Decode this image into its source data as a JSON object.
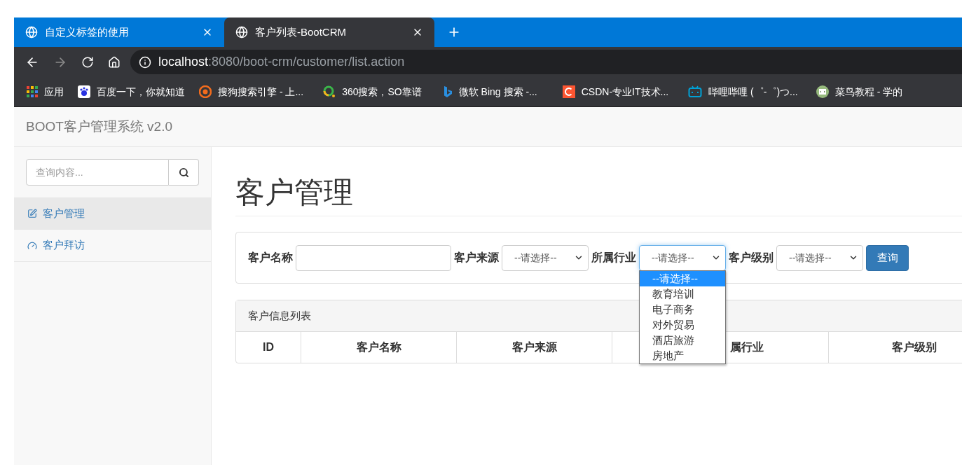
{
  "browser": {
    "tabs": [
      {
        "title": "自定义标签的使用",
        "selected": false
      },
      {
        "title": "客户列表-BootCRM",
        "selected": true
      }
    ],
    "url": {
      "host": "localhost",
      "rest": ":8080/boot-crm/customer/list.action"
    },
    "bookmarks": [
      {
        "label": "应用",
        "kind": "apps"
      },
      {
        "label": "百度一下，你就知道",
        "kind": "paw"
      },
      {
        "label": "搜狗搜索引擎 - 上...",
        "kind": "scircle"
      },
      {
        "label": "360搜索，SO靠谱",
        "kind": "ring"
      },
      {
        "label": "微软 Bing 搜索 -...",
        "kind": "ribbon"
      },
      {
        "label": "CSDN-专业IT技术...",
        "kind": "csquare"
      },
      {
        "label": "哔哩哔哩 (゜-゜)つ...",
        "kind": "tv"
      },
      {
        "label": "菜鸟教程 - 学的",
        "kind": "codebadge"
      }
    ]
  },
  "navbar": {
    "brand": "BOOT客户管理系统 v2.0"
  },
  "sidebar": {
    "search": {
      "placeholder": "查询内容..."
    },
    "items": [
      {
        "label": "客户管理",
        "kind": "edit",
        "selected": true
      },
      {
        "label": "客户拜访",
        "kind": "gauge",
        "selected": false
      }
    ]
  },
  "page": {
    "title": "客户管理",
    "filters": [
      {
        "label": "客户名称",
        "kind": "text"
      },
      {
        "label": "客户来源",
        "kind": "select",
        "value": "--请选择--",
        "open": false
      },
      {
        "label": "所属行业",
        "kind": "select",
        "value": "--请选择--",
        "open": true
      },
      {
        "label": "客户级别",
        "kind": "select",
        "value": "--请选择--",
        "open": false
      }
    ],
    "query_button": "查询",
    "dropdown_options": [
      {
        "label": "--请选择--",
        "selected": true
      },
      {
        "label": "教育培训",
        "selected": false
      },
      {
        "label": "电子商务",
        "selected": false
      },
      {
        "label": "对外贸易",
        "selected": false
      },
      {
        "label": "酒店旅游",
        "selected": false
      },
      {
        "label": "房地产",
        "selected": false
      }
    ],
    "panel_title": "客户信息列表",
    "table": {
      "columns": [
        "ID",
        "客户名称",
        "客户来源",
        "属行业",
        "客户级别"
      ]
    }
  }
}
